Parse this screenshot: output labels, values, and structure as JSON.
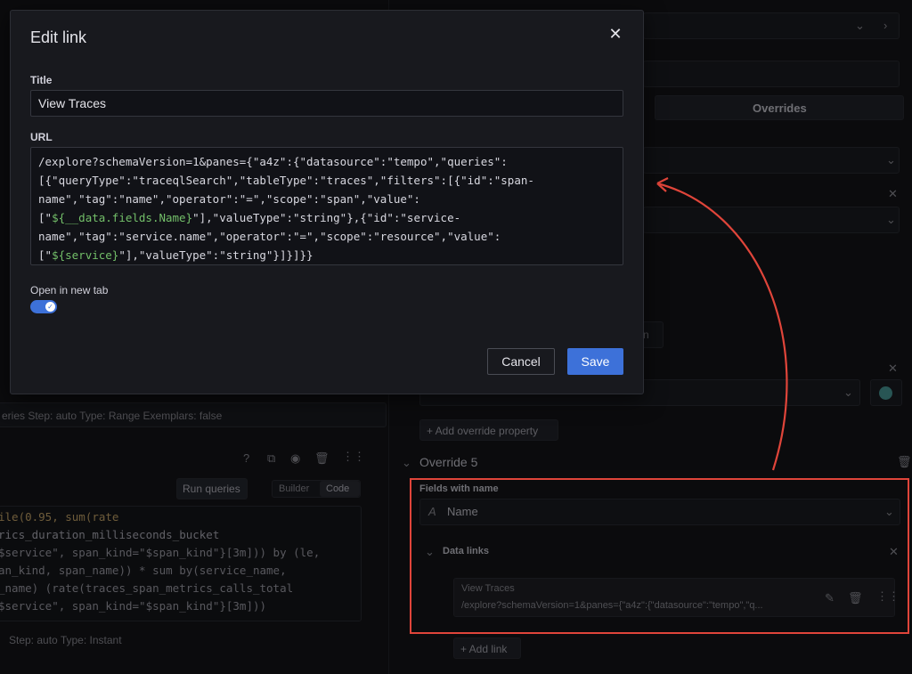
{
  "modal": {
    "title": "Edit link",
    "title_label": "Title",
    "title_value": "View Traces",
    "url_label": "URL",
    "url_lines": [
      [
        {
          "t": "/explore?schemaVersion=1&panes={\"a4z\":{\"datasource\":\"tempo\",\"queries\":"
        }
      ],
      [
        {
          "t": "[{\"queryType\":\"traceqlSearch\",\"tableType\":\"traces\",\"filters\":[{\"id\":\"span-"
        }
      ],
      [
        {
          "t": "name\",\"tag\":\"name\",\"operator\":\"=\",\"scope\":\"span\",\"value\":"
        }
      ],
      [
        {
          "t": "[\""
        },
        {
          "t": "${__data.fields.Name}",
          "v": true
        },
        {
          "t": "\"],\"valueType\":\"string\"},{\"id\":\"service-"
        }
      ],
      [
        {
          "t": "name\",\"tag\":\"service.name\",\"operator\":\"=\",\"scope\":\"resource\",\"value\":"
        }
      ],
      [
        {
          "t": "[\""
        },
        {
          "t": "${service}",
          "v": true
        },
        {
          "t": "\"],\"valueType\":\"string\"}]}]}}"
        }
      ]
    ],
    "open_new_tab_label": "Open in new tab",
    "open_new_tab": true,
    "cancel_label": "Cancel",
    "save_label": "Save"
  },
  "background": {
    "overrides_tab": "Overrides",
    "query_meta_1": "eries    Step: auto    Type: Range    Exemplars: false",
    "run_queries": "Run queries",
    "builder": "Builder",
    "code": "Code",
    "query_lines": [
      "ile(0.95, sum(rate",
      "rics_duration_milliseconds_bucket",
      "$service\", span_kind=\"$span_kind\"}[3m])) by (le,",
      "an_kind, span_name)) * sum by(service_name,",
      "_name) (rate(traces_span_metrics_calls_total",
      "$service\", span_kind=\"$span_kind\"}[3m]))"
    ],
    "query_meta_2": "Step: auto    Type: Instant",
    "add_override_property": "+ Add override property",
    "override_title": "Override 5",
    "fields_with_name": "Fields with name",
    "field_value": "Name",
    "data_links": "Data links",
    "link_title": "View Traces",
    "link_url": "/explore?schemaVersion=1&panes={\"a4z\":{\"datasource\":\"tempo\",\"q...",
    "add_link": "+ Add link",
    "stub_text": "n"
  }
}
